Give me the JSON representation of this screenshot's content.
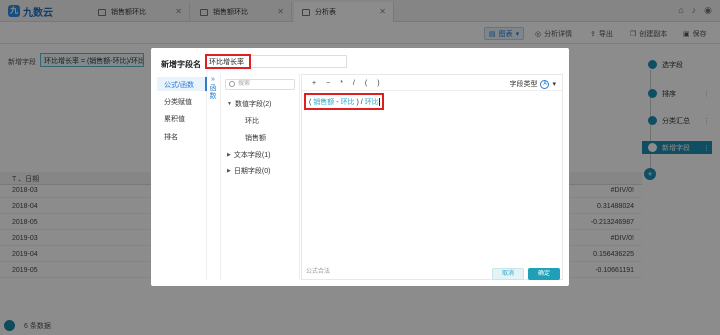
{
  "app": {
    "logo_text": "九数云"
  },
  "tabs": [
    {
      "label": "销售额环比"
    },
    {
      "label": "销售额环比"
    },
    {
      "label": "分析表"
    }
  ],
  "toolbar": {
    "chart_label": "图表",
    "analysis_label": "分析详情",
    "export_label": "导出",
    "copy_label": "创建副本",
    "save_label": "保存"
  },
  "background": {
    "new_field_label": "新增字段",
    "formula_chip": "环比增长率 = (销售额-环比)/环比",
    "date_header": "日期",
    "rows": [
      {
        "date": "2018-03",
        "value": "#DIV/0!"
      },
      {
        "date": "2018-04",
        "value": "0.31488024"
      },
      {
        "date": "2018-05",
        "value": "-0.213246987"
      },
      {
        "date": "2019-03",
        "value": "#DIV/0!"
      },
      {
        "date": "2019-04",
        "value": "0.156436225"
      },
      {
        "date": "2019-05",
        "value": "-0.10661191"
      }
    ],
    "row_count": "6",
    "row_count_suffix": "条数据"
  },
  "steps": [
    {
      "label": "选字段"
    },
    {
      "label": "排序"
    },
    {
      "label": "分类汇总"
    },
    {
      "label": "新增字段"
    }
  ],
  "modal": {
    "title": "新增字段名",
    "field_name": "环比增长率",
    "nav": [
      "公式/函数",
      "分类赋值",
      "累积值",
      "排名"
    ],
    "collapse_label": "函数",
    "search_placeholder": "搜索",
    "numeric_group": "数值字段(2)",
    "numeric_fields": [
      "环比",
      "销售额"
    ],
    "text_group": "文本字段(1)",
    "date_group": "日期字段(0)",
    "operators": [
      "+",
      "−",
      "*",
      "/",
      "(",
      ")"
    ],
    "field_type_label": "字段类型",
    "expression": {
      "open_paren": "(",
      "field1": "销售额",
      "minus": "-",
      "field2": "环比",
      "close_div": ") /",
      "field3": "环比"
    },
    "formula_valid": "公式合法",
    "cancel_label": "取消",
    "confirm_label": "确定"
  }
}
